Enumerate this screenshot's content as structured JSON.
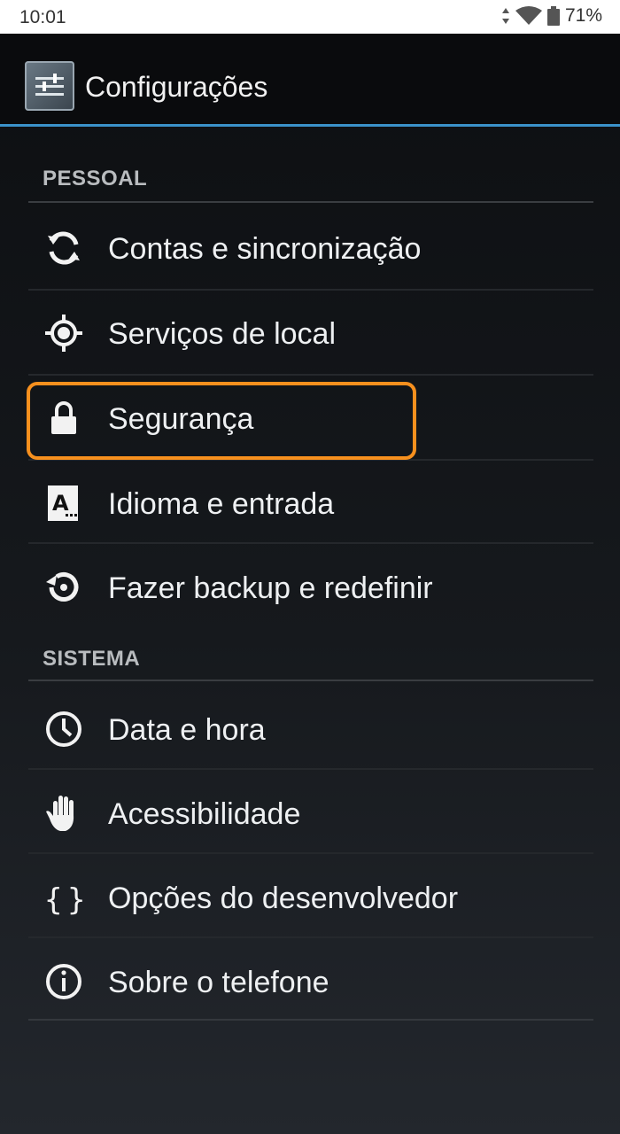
{
  "status": {
    "time": "10:01",
    "battery": "71%"
  },
  "actionbar": {
    "title": "Configurações"
  },
  "sections": {
    "personal": "PESSOAL",
    "system": "SISTEMA"
  },
  "items": [
    {
      "label": "Contas e sincronização",
      "icon": "sync-icon"
    },
    {
      "label": "Serviços de local",
      "icon": "location-icon"
    },
    {
      "label": "Segurança",
      "icon": "lock-icon"
    },
    {
      "label": "Idioma e entrada",
      "icon": "language-icon"
    },
    {
      "label": "Fazer backup e redefinir",
      "icon": "backup-icon"
    },
    {
      "label": "Data e hora",
      "icon": "clock-icon"
    },
    {
      "label": "Acessibilidade",
      "icon": "hand-icon"
    },
    {
      "label": "Opções do desenvolvedor",
      "icon": "braces-icon"
    },
    {
      "label": "Sobre o telefone",
      "icon": "info-icon"
    }
  ],
  "colors": {
    "accent": "#3b92c9",
    "highlight": "#f7901e"
  }
}
